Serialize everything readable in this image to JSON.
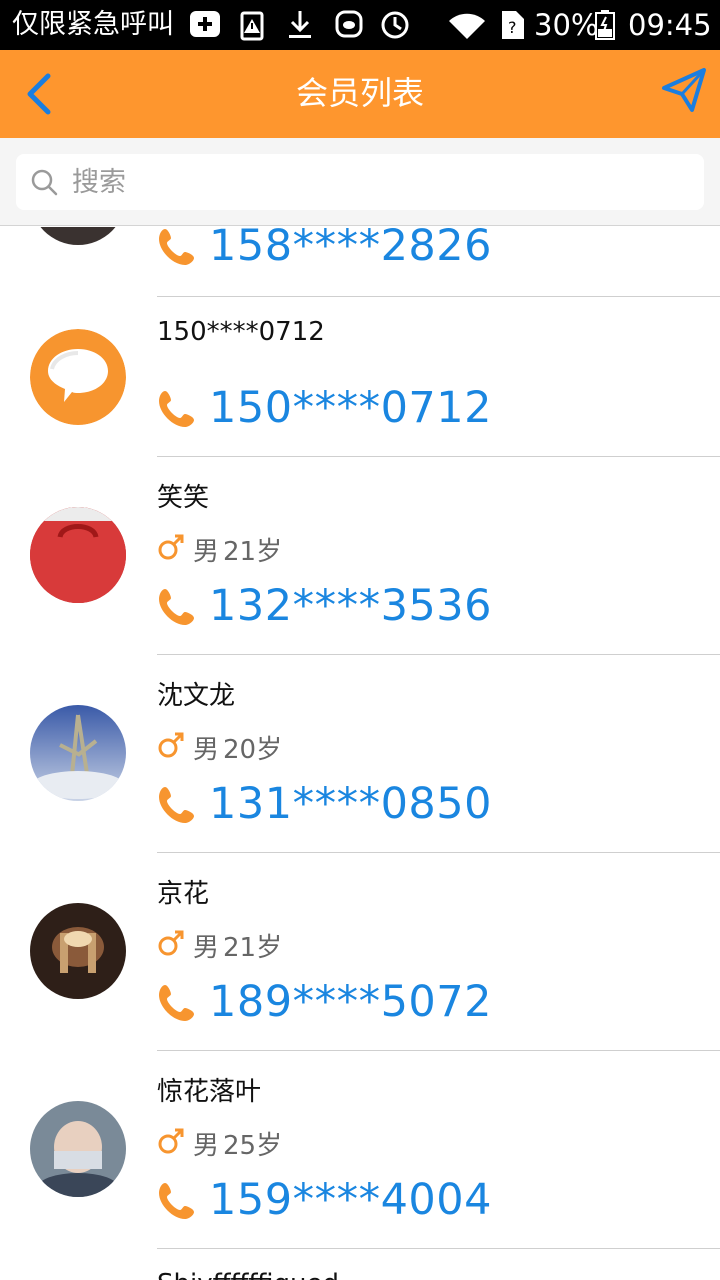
{
  "status_bar": {
    "carrier": "仅限紧急呼叫",
    "battery": "30%",
    "time": "09:45",
    "icons": [
      "add-icon",
      "warning-icon",
      "download-icon",
      "app-icon",
      "sync-icon",
      "wifi-icon",
      "no-sim-icon",
      "battery-icon"
    ]
  },
  "header": {
    "title": "会员列表",
    "back_icon": "chevron-left-icon",
    "action_icon": "send-icon",
    "accent": "#fe962e"
  },
  "search": {
    "placeholder": "搜索"
  },
  "members": [
    {
      "name": "",
      "gender": "",
      "age": "",
      "phone": "158****2826",
      "partial": true
    },
    {
      "name": "150****0712",
      "gender": "",
      "age": "",
      "phone": "150****0712",
      "avatar": "default-chat"
    },
    {
      "name": "笑笑",
      "gender": "男",
      "age": "21岁",
      "phone": "132****3536",
      "avatar": "red-bag"
    },
    {
      "name": "沈文龙",
      "gender": "男",
      "age": "20岁",
      "phone": "131****0850",
      "avatar": "plant-sky"
    },
    {
      "name": "京花",
      "gender": "男",
      "age": "21岁",
      "phone": "189****5072",
      "avatar": "dark-room"
    },
    {
      "name": "惊花落叶",
      "gender": "男",
      "age": "25岁",
      "phone": "159****4004",
      "avatar": "baby"
    },
    {
      "name": "Shiyffffffigued",
      "gender": "",
      "age": "",
      "phone": "",
      "partial": true
    }
  ],
  "colors": {
    "phone_text": "#1a86e0",
    "icon_orange": "#f7952f"
  }
}
